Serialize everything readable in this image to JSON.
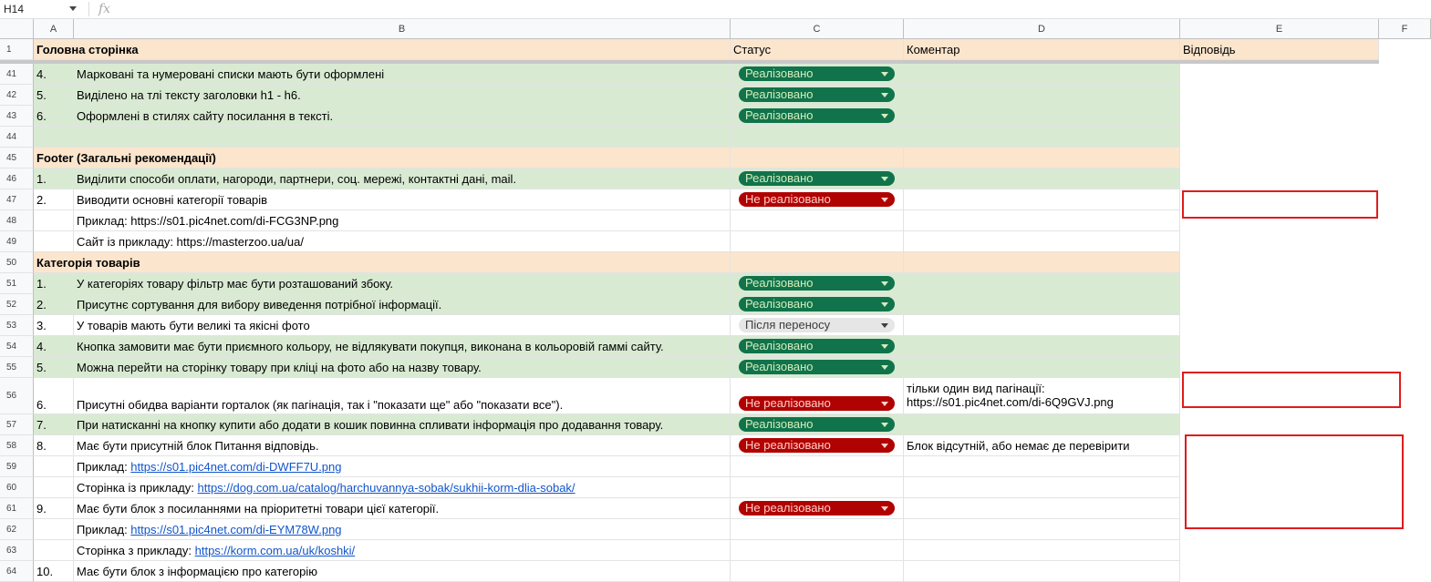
{
  "formula_bar": {
    "cell_ref": "H14",
    "fx_label": "fx"
  },
  "columns": [
    "A",
    "B",
    "C",
    "D",
    "E",
    "F"
  ],
  "header": {
    "row_num": "1",
    "a": "Головна сторінка",
    "c": "Статус",
    "d": "Коментар",
    "e": "Відповідь"
  },
  "colors": {
    "peach": "#fce5cd",
    "green": "#d9ead3",
    "implemented": "#11734b",
    "not_implemented": "#b10202",
    "after_transfer": "#e6e6e6",
    "annotation": "#e01b1b"
  },
  "rows": [
    {
      "num": "41",
      "a": "4.",
      "b": "Марковані та нумеровані списки мають бути оформлені",
      "status": "Реалізовано",
      "d": ""
    },
    {
      "num": "42",
      "a": "5.",
      "b": "Виділено на тлі тексту заголовки h1 - h6.",
      "status": "Реалізовано",
      "d": ""
    },
    {
      "num": "43",
      "a": "6.",
      "b": "Оформлені в стилях сайту посилання в тексті.",
      "status": "Реалізовано",
      "d": ""
    },
    {
      "num": "44",
      "a": "",
      "b": "",
      "status": "",
      "d": ""
    },
    {
      "num": "45",
      "section": "Footer (Загальні рекомендації)"
    },
    {
      "num": "46",
      "a": "1.",
      "b": "Виділити способи оплати, нагороди, партнери, соц. мережі, контактні дані, mail.",
      "status": "Реалізовано",
      "d": ""
    },
    {
      "num": "47",
      "a": "2.",
      "b": "Виводити основні категорії товарів",
      "status": "Не реалізовано",
      "d": ""
    },
    {
      "num": "48",
      "a": "",
      "b": "Приклад: https://s01.pic4net.com/di-FCG3NP.png",
      "status": "",
      "d": ""
    },
    {
      "num": "49",
      "a": "",
      "b": "Сайт із прикладу: https://masterzoo.ua/ua/",
      "status": "",
      "d": ""
    },
    {
      "num": "50",
      "section": "Категорія товарів"
    },
    {
      "num": "51",
      "a": "1.",
      "b": "У категоріях товару фільтр має бути розташований збоку.",
      "status": "Реалізовано",
      "d": ""
    },
    {
      "num": "52",
      "a": "2.",
      "b": "Присутнє сортування для вибору виведення потрібної інформації.",
      "status": "Реалізовано",
      "d": ""
    },
    {
      "num": "53",
      "a": "3.",
      "b": "У товарів мають бути великі та якісні фото",
      "status": "Після переносу",
      "d": ""
    },
    {
      "num": "54",
      "a": "4.",
      "b": "Кнопка замовити має бути приємного кольору, не відлякувати покупця, виконана в кольоровій гаммі сайту.",
      "status": "Реалізовано",
      "d": ""
    },
    {
      "num": "55",
      "a": "5.",
      "b": "Можна перейти на сторінку товару при кліці на фото або на назву товару.",
      "status": "Реалізовано",
      "d": ""
    },
    {
      "num": "56",
      "a": "6.",
      "b": "Присутні обидва варіанти горталок (як пагінація, так і \"показати ще\" або \"показати все\").",
      "status": "Не реалізовано",
      "d1": "тільки один вид пагінації:",
      "d2": "https://s01.pic4net.com/di-6Q9GVJ.png"
    },
    {
      "num": "57",
      "a": "7.",
      "b": "При натисканні на кнопку купити або додати в кошик повинна спливати інформація про додавання товару.",
      "status": "Реалізовано",
      "d": ""
    },
    {
      "num": "58",
      "a": "8.",
      "b": "Має бути присутній блок Питання відповідь.",
      "status": "Не реалізовано",
      "d": "Блок відсутній, або немає де перевірити"
    },
    {
      "num": "59",
      "a": "",
      "b_label": "Приклад: ",
      "b_link": "https://s01.pic4net.com/di-DWFF7U.png",
      "status": "",
      "d": ""
    },
    {
      "num": "60",
      "a": "",
      "b_label": "Сторінка із прикладу: ",
      "b_link": "https://dog.com.ua/catalog/harchuvannya-sobak/sukhii-korm-dlia-sobak/",
      "status": "",
      "d": ""
    },
    {
      "num": "61",
      "a": "9.",
      "b": "Має бути блок з посиланнями на пріоритетні товари цієї категорії.",
      "status": "Не реалізовано",
      "d": ""
    },
    {
      "num": "62",
      "a": "",
      "b_label": "Приклад: ",
      "b_link": "https://s01.pic4net.com/di-EYM78W.png",
      "status": "",
      "d": ""
    },
    {
      "num": "63",
      "a": "",
      "b_label": "Сторінка з прикладу: ",
      "b_link": "https://korm.com.ua/uk/koshki/",
      "status": "",
      "d": ""
    },
    {
      "num": "64",
      "a": "10.",
      "b": "Має бути блок з інформацією про категорію",
      "status": "",
      "d": ""
    }
  ]
}
